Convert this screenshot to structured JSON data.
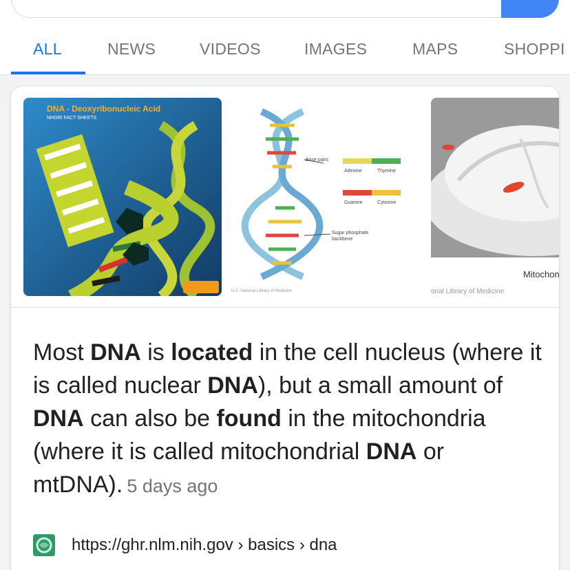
{
  "tabs": [
    {
      "label": "ALL"
    },
    {
      "label": "NEWS"
    },
    {
      "label": "VIDEOS"
    },
    {
      "label": "IMAGES"
    },
    {
      "label": "MAPS"
    },
    {
      "label": "SHOPPI"
    }
  ],
  "images": {
    "dna_factsheet": {
      "title": "DNA - Deoxyribonucleic Acid",
      "subtitle": "NHGRI FACT SHEETS"
    },
    "dna_diagram": {
      "base_pairs_label": "Base pairs",
      "adenine": "Adenine",
      "thymine": "Thymine",
      "guanine": "Guanine",
      "cytosine": "Cytosine",
      "backbone_label_1": "Sugar phosphate",
      "backbone_label_2": "backbone",
      "credit": "U.S. National Library of Medicine"
    },
    "mitochondria": {
      "label": "Mitochonc",
      "credit": "onal Library of Medicine"
    }
  },
  "snippet": {
    "p1": "Most ",
    "b1": "DNA",
    "p2": " is ",
    "b2": "located",
    "p3": " in the cell nucleus (where it is called nuclear ",
    "b3": "DNA",
    "p4": "), but a small amount of ",
    "b4": "DNA",
    "p5": " can also be ",
    "b5": "found",
    "p6": " in the mitochondria (where it is called mitochondrial ",
    "b6": "DNA",
    "p7": " or mtDNA).",
    "date": "5 days ago"
  },
  "source": {
    "url": "https://ghr.nlm.nih.gov › basics › dna"
  },
  "colors": {
    "accent": "#1a73e8",
    "search_button": "#4285f4"
  }
}
